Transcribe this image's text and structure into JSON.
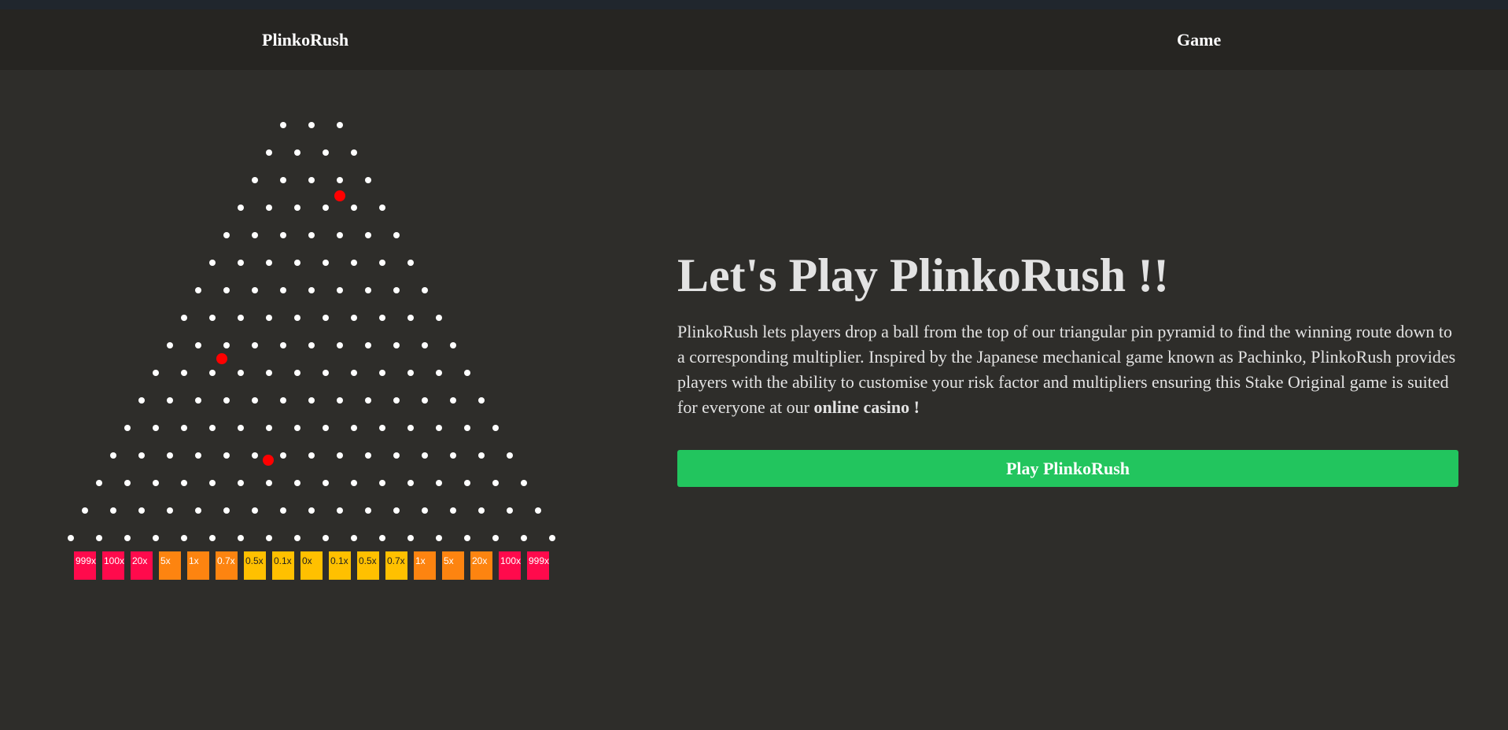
{
  "nav": {
    "brand": "PlinkoRush",
    "game_link": "Game"
  },
  "board": {
    "peg_rows": 16,
    "top_row_pegs": 3,
    "bottom_row_pegs": 18,
    "balls_in_flight": 3,
    "multipliers": [
      {
        "label": "999x",
        "tier": "red"
      },
      {
        "label": "100x",
        "tier": "red"
      },
      {
        "label": "20x",
        "tier": "red"
      },
      {
        "label": "5x",
        "tier": "orange"
      },
      {
        "label": "1x",
        "tier": "orange"
      },
      {
        "label": "0.7x",
        "tier": "orange"
      },
      {
        "label": "0.5x",
        "tier": "yellow"
      },
      {
        "label": "0.1x",
        "tier": "yellow"
      },
      {
        "label": "0x",
        "tier": "yellow"
      },
      {
        "label": "0.1x",
        "tier": "yellow"
      },
      {
        "label": "0.5x",
        "tier": "yellow"
      },
      {
        "label": "0.7x",
        "tier": "yellow"
      },
      {
        "label": "1x",
        "tier": "orange"
      },
      {
        "label": "5x",
        "tier": "orange"
      },
      {
        "label": "20x",
        "tier": "orange"
      },
      {
        "label": "100x",
        "tier": "red"
      },
      {
        "label": "999x",
        "tier": "red"
      }
    ],
    "colors": {
      "peg": "#ffffff",
      "ball": "#ff0000",
      "red": "#ff0a4c",
      "orange": "#fd8410",
      "yellow": "#ffc000"
    }
  },
  "hero": {
    "title": "Let's Play PlinkoRush !!",
    "description": "PlinkoRush lets players drop a ball from the top of our triangular pin pyramid to find the winning route down to a corresponding multiplier. Inspired by the Japanese mechanical game known as Pachinko, PlinkoRush provides players with the ability to customise your risk factor and multipliers ensuring this Stake Original game is suited for everyone at our",
    "description_highlight": "online casino !",
    "play_button": "Play PlinkoRush"
  },
  "colors": {
    "background": "#2e2d2a",
    "navbar": "#262522",
    "accent_green": "#22c55e"
  }
}
